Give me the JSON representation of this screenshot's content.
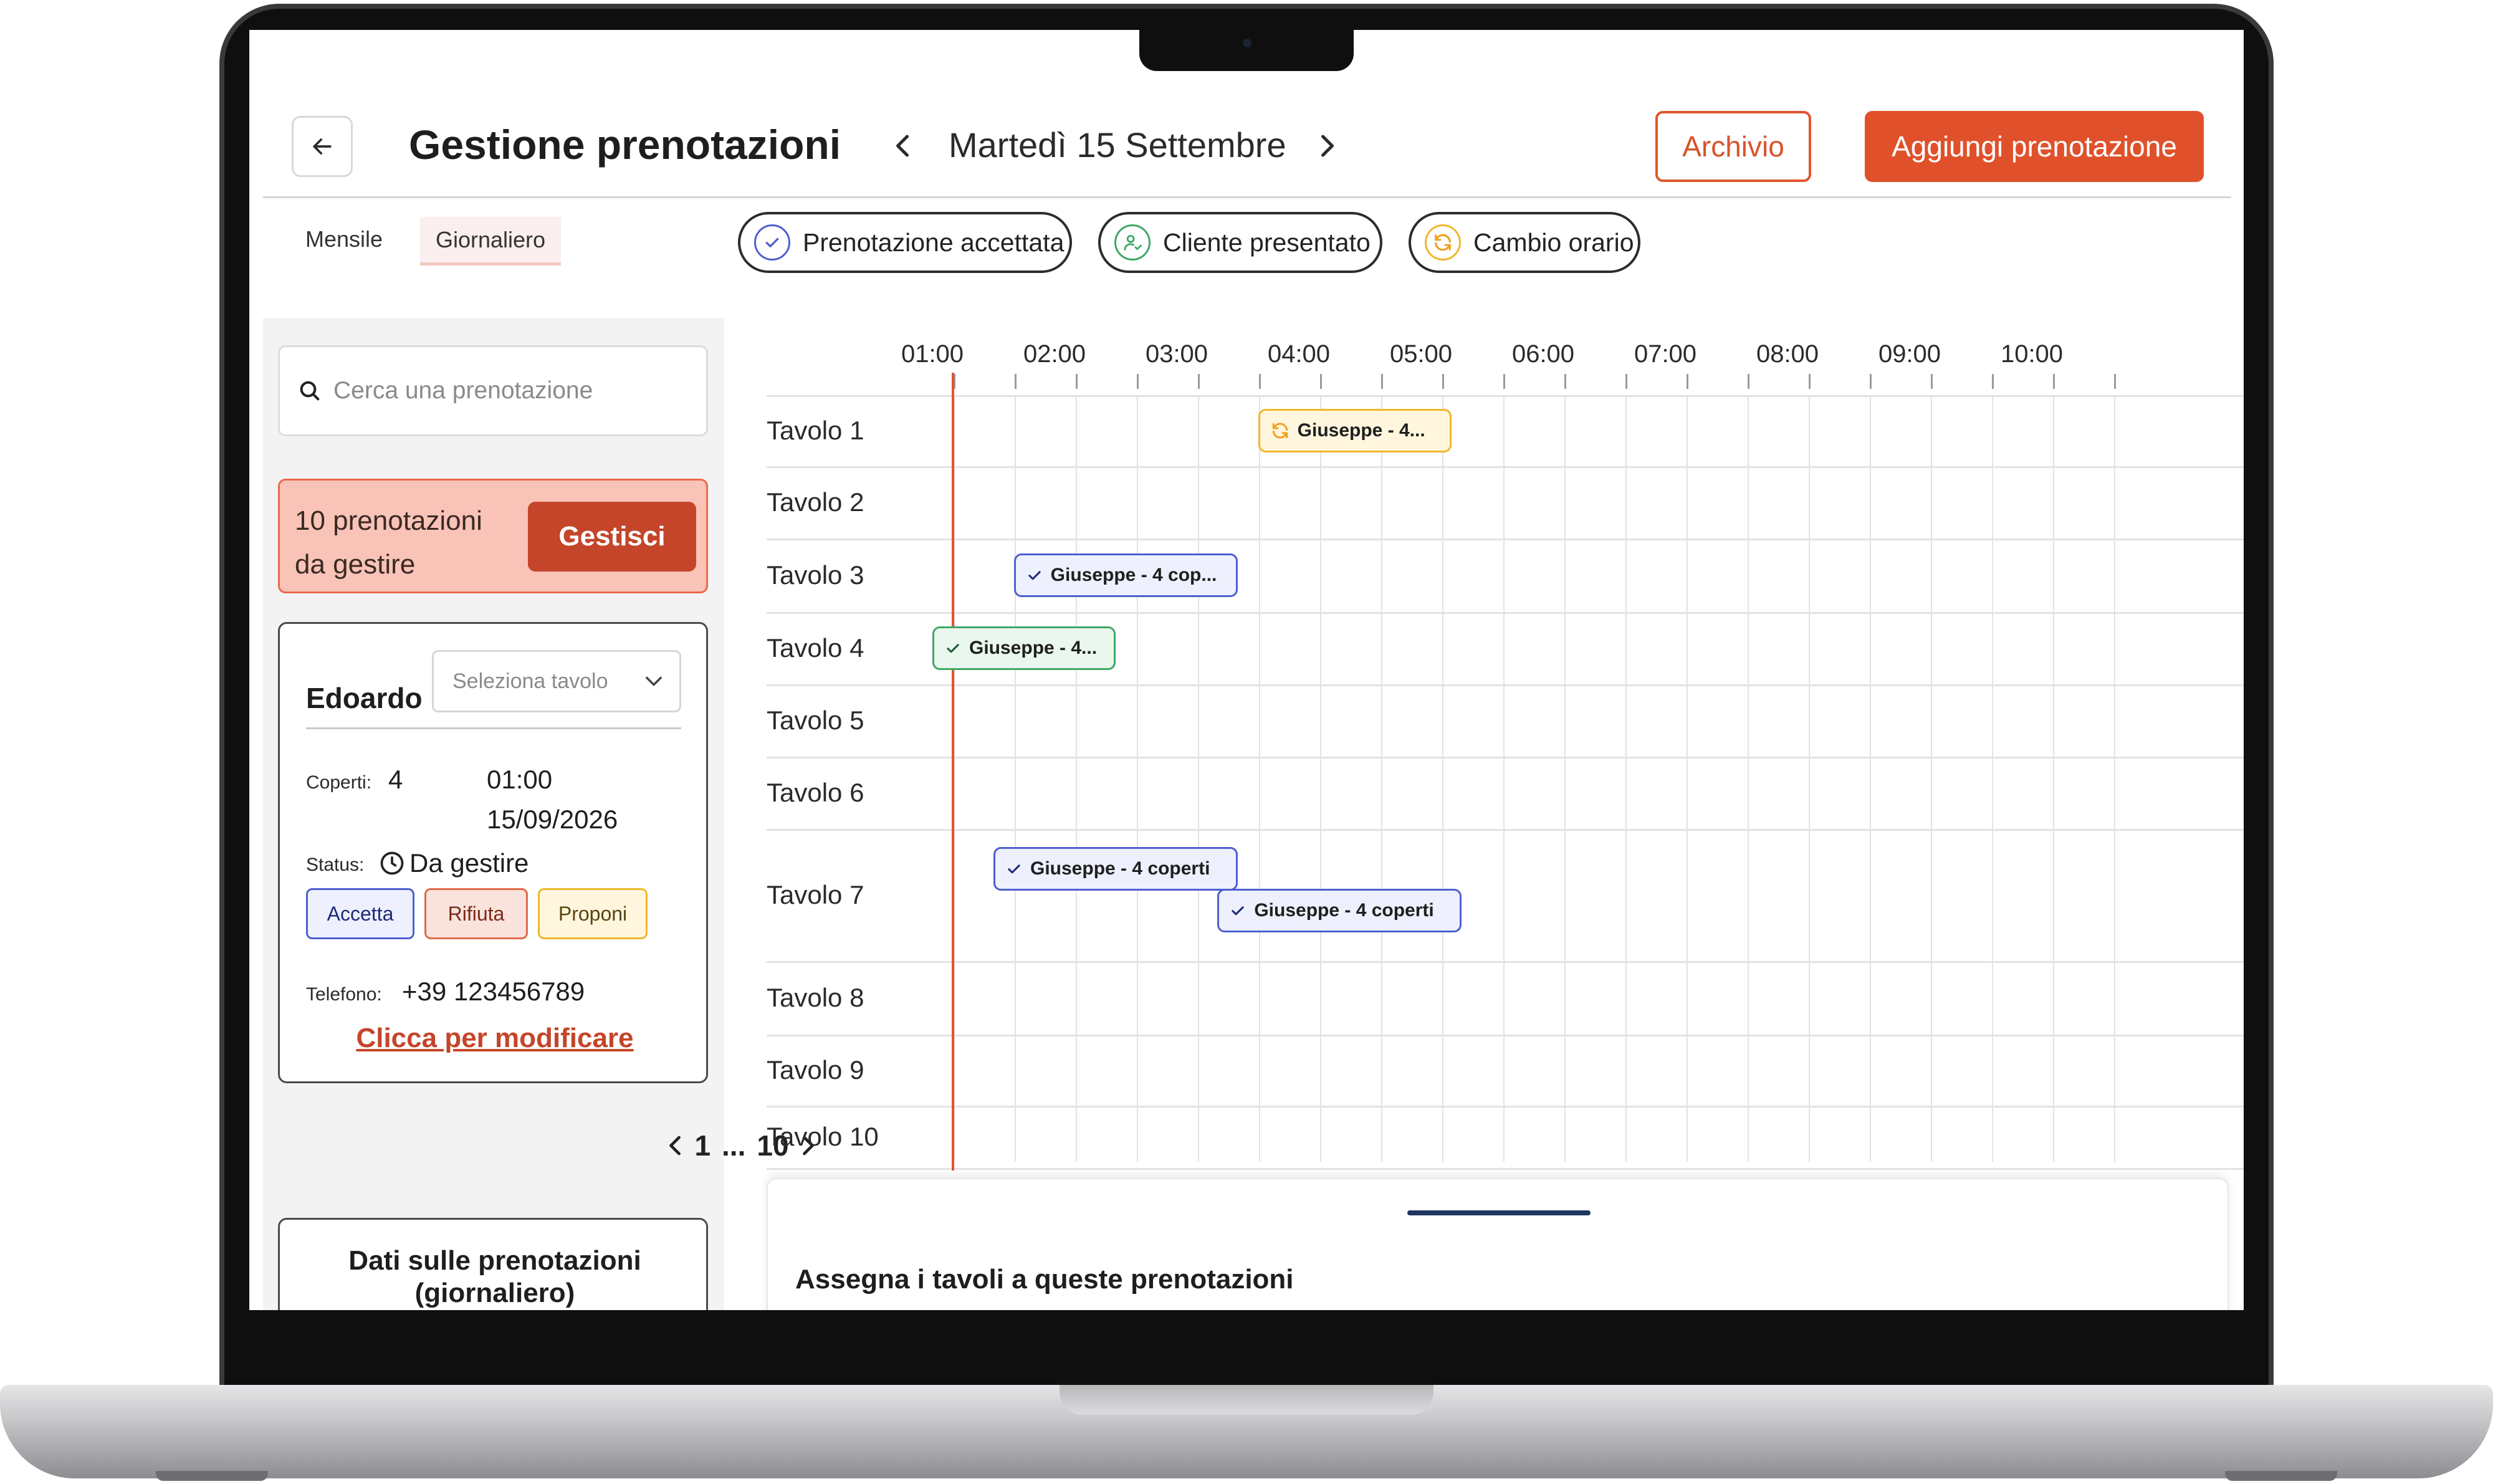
{
  "header": {
    "title": "Gestione prenotazioni",
    "date": "Martedì 15 Settembre",
    "archive_label": "Archivio",
    "add_label": "Aggiungi prenotazione"
  },
  "views": {
    "monthly": "Mensile",
    "daily": "Giornaliero"
  },
  "legend": {
    "accepted": "Prenotazione accettata",
    "arrived": "Cliente presentato",
    "changed": "Cambio orario"
  },
  "colors": {
    "accent": "#e0512b",
    "accepted": "#4d5fcf",
    "arrived": "#3ea866",
    "changed": "#f0b62d"
  },
  "sidebar": {
    "search_placeholder": "Cerca una prenotazione",
    "pending": {
      "text": "10 prenotazioni da gestire",
      "button": "Gestisci"
    },
    "reservation": {
      "name": "Edoardo",
      "table_placeholder": "Seleziona tavolo",
      "covers_label": "Coperti:",
      "covers": "4",
      "time": "01:00",
      "date": "15/09/2026",
      "status_label": "Status:",
      "status": "Da gestire",
      "accept": "Accetta",
      "reject": "Rifiuta",
      "propose": "Proponi",
      "phone_label": "Telefono:",
      "phone": "+39 123456789",
      "edit_link": "Clicca per modificare"
    },
    "pagination": {
      "current": "1",
      "ellipsis": "...",
      "last": "10"
    },
    "stats": {
      "title_line1": "Dati sulle prenotazioni",
      "title_line2": "(giornaliero)"
    }
  },
  "timeline": {
    "hours": [
      "01:00",
      "02:00",
      "03:00",
      "04:00",
      "05:00",
      "06:00",
      "07:00",
      "08:00",
      "09:00",
      "10:00"
    ],
    "tables": [
      "Tavolo 1",
      "Tavolo 2",
      "Tavolo 3",
      "Tavolo 4",
      "Tavolo 5",
      "Tavolo 6",
      "Tavolo 7",
      "Tavolo 8",
      "Tavolo 9",
      "Tavolo 10"
    ],
    "current_time": "01:10",
    "reservations": [
      {
        "table": "Tavolo 1",
        "status": "changed",
        "label": "Giuseppe - 4...",
        "start": "03:40",
        "end": "05:15"
      },
      {
        "table": "Tavolo 3",
        "status": "accepted",
        "label": "Giuseppe - 4 cop...",
        "start": "01:40",
        "end": "03:30"
      },
      {
        "table": "Tavolo 4",
        "status": "arrived",
        "label": "Giuseppe - 4...",
        "start": "01:00",
        "end": "02:30"
      },
      {
        "table": "Tavolo 7",
        "status": "accepted",
        "label": "Giuseppe - 4 coperti",
        "start": "01:30",
        "end": "03:30"
      },
      {
        "table": "Tavolo 7",
        "status": "accepted",
        "label": "Giuseppe - 4 coperti",
        "start": "03:20",
        "end": "05:20"
      }
    ]
  },
  "drawer": {
    "title": "Assegna i tavoli a queste prenotazioni"
  }
}
